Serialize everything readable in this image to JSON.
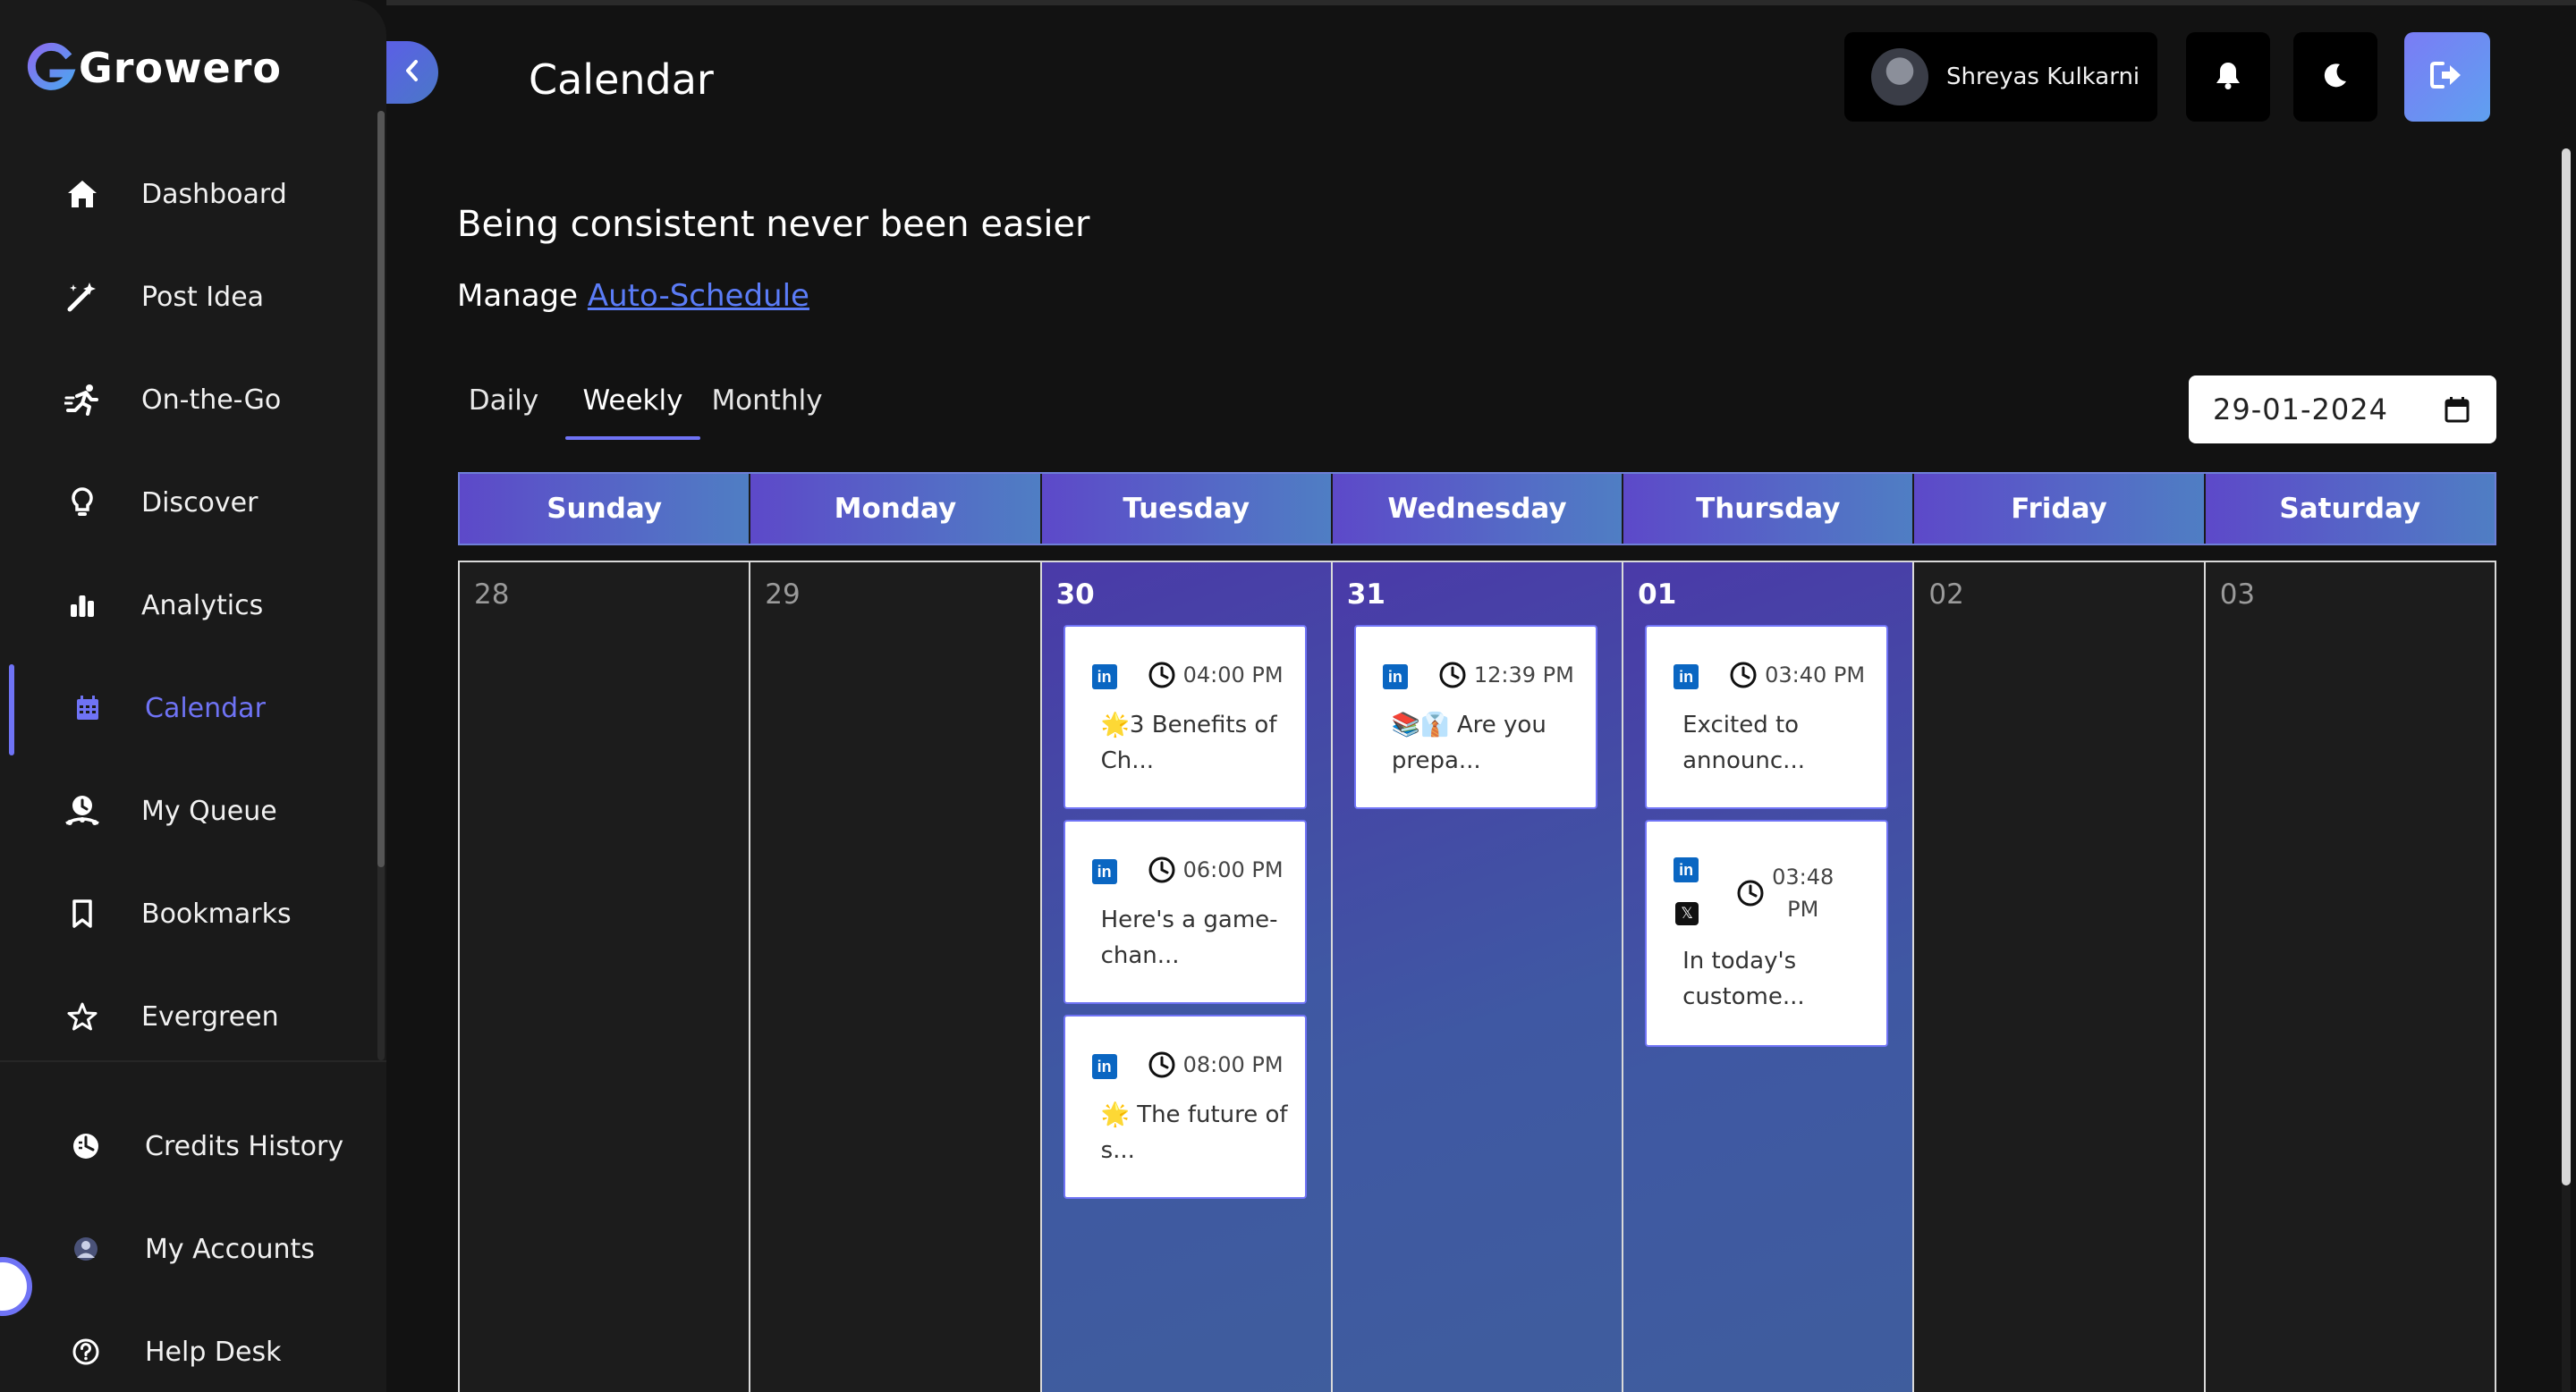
{
  "brand": {
    "name": "Growero"
  },
  "sidebar": {
    "items": [
      {
        "label": "Dashboard",
        "icon": "home-icon"
      },
      {
        "label": "Post Idea",
        "icon": "magic-wand-icon"
      },
      {
        "label": "On-the-Go",
        "icon": "running-icon"
      },
      {
        "label": "Discover",
        "icon": "lightbulb-icon"
      },
      {
        "label": "Analytics",
        "icon": "bar-chart-icon"
      },
      {
        "label": "Calendar",
        "icon": "calendar-icon",
        "active": true
      },
      {
        "label": "My Queue",
        "icon": "queue-icon"
      },
      {
        "label": "Bookmarks",
        "icon": "bookmark-icon"
      },
      {
        "label": "Evergreen",
        "icon": "star-icon"
      }
    ],
    "bottom_items": [
      {
        "label": "Credits History",
        "icon": "credits-icon"
      },
      {
        "label": "My Accounts",
        "icon": "account-avatar-icon"
      },
      {
        "label": "Help Desk",
        "icon": "help-icon"
      }
    ]
  },
  "header": {
    "title": "Calendar",
    "user_name": "Shreyas Kulkarni"
  },
  "main": {
    "headline": "Being consistent never been easier",
    "manage_prefix": "Manage",
    "manage_link": "Auto-Schedule",
    "tabs": [
      {
        "label": "Daily"
      },
      {
        "label": "Weekly",
        "active": true
      },
      {
        "label": "Monthly"
      }
    ],
    "date_value": "29-01-2024"
  },
  "calendar": {
    "days": [
      {
        "name": "Sunday",
        "date": "28",
        "posts": []
      },
      {
        "name": "Monday",
        "date": "29",
        "posts": []
      },
      {
        "name": "Tuesday",
        "date": "30",
        "posts": [
          {
            "time": "04:00 PM",
            "text": "🌟3 Benefits of Ch..."
          },
          {
            "time": "06:00 PM",
            "text": "Here's a game-chan..."
          },
          {
            "time": "08:00 PM",
            "text": "🌟 The future of s..."
          }
        ]
      },
      {
        "name": "Wednesday",
        "date": "31",
        "posts": [
          {
            "time": "12:39 PM",
            "text": "📚👔 Are you prepa..."
          }
        ]
      },
      {
        "name": "Thursday",
        "date": "01",
        "posts": [
          {
            "time": "03:40 PM",
            "text": "Excited to announc..."
          },
          {
            "time_line1": "03:48",
            "time_line2": "PM",
            "text": "In today's custome..."
          }
        ]
      },
      {
        "name": "Friday",
        "date": "02",
        "posts": []
      },
      {
        "name": "Saturday",
        "date": "03",
        "posts": []
      }
    ]
  },
  "colors": {
    "accent": "#6f73f5",
    "link": "#5b7cf7",
    "linkedin": "#0a66c2"
  }
}
